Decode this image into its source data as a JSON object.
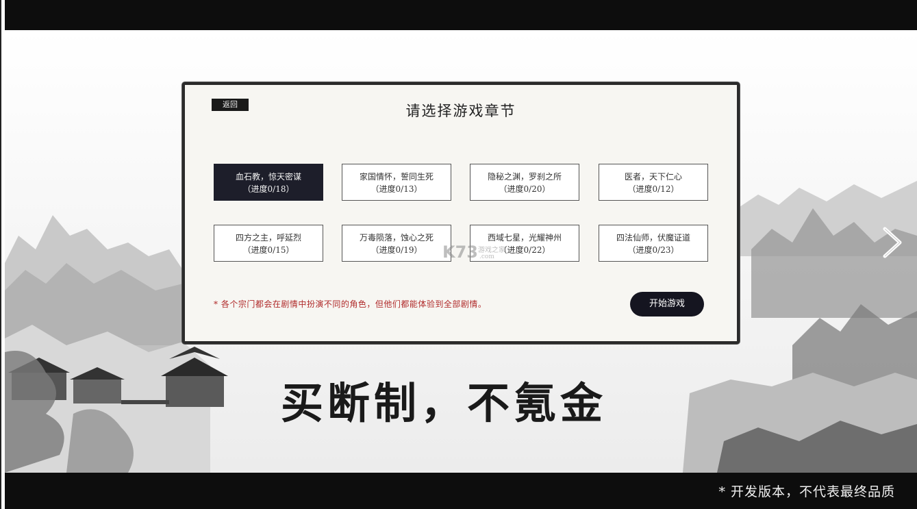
{
  "panel": {
    "back_label": "返回",
    "title": "请选择游戏章节",
    "chapters": [
      {
        "title": "血石教，惊天密谋",
        "progress": "（进度0/18）",
        "selected": true
      },
      {
        "title": "家国情怀，誓同生死",
        "progress": "（进度0/13）",
        "selected": false
      },
      {
        "title": "隐秘之渊，罗刹之所",
        "progress": "（进度0/20）",
        "selected": false
      },
      {
        "title": "医者，天下仁心",
        "progress": "（进度0/12）",
        "selected": false
      },
      {
        "title": "四方之主，呼延烈",
        "progress": "（进度0/15）",
        "selected": false
      },
      {
        "title": "万毒陨落，蚀心之死",
        "progress": "（进度0/19）",
        "selected": false
      },
      {
        "title": "西域七星，光耀神州",
        "progress": "（进度0/22）",
        "selected": false
      },
      {
        "title": "四法仙师，伏魔证道",
        "progress": "（进度0/23）",
        "selected": false
      }
    ],
    "note": "* 各个宗门都会在剧情中扮演不同的角色，但他们都能体验到全部剧情。",
    "start_label": "开始游戏"
  },
  "slogan": "买断制，不氪金",
  "footer_note": "* 开发版本，不代表最终品质",
  "watermark": {
    "logo": "K73",
    "sub": "游戏之家",
    "url": ".com"
  },
  "icons": {
    "next": "chevron-right-icon"
  },
  "colors": {
    "bar": "#0d0d0d",
    "selected_chapter": "#1d1e2a",
    "note": "#b02a2a"
  }
}
